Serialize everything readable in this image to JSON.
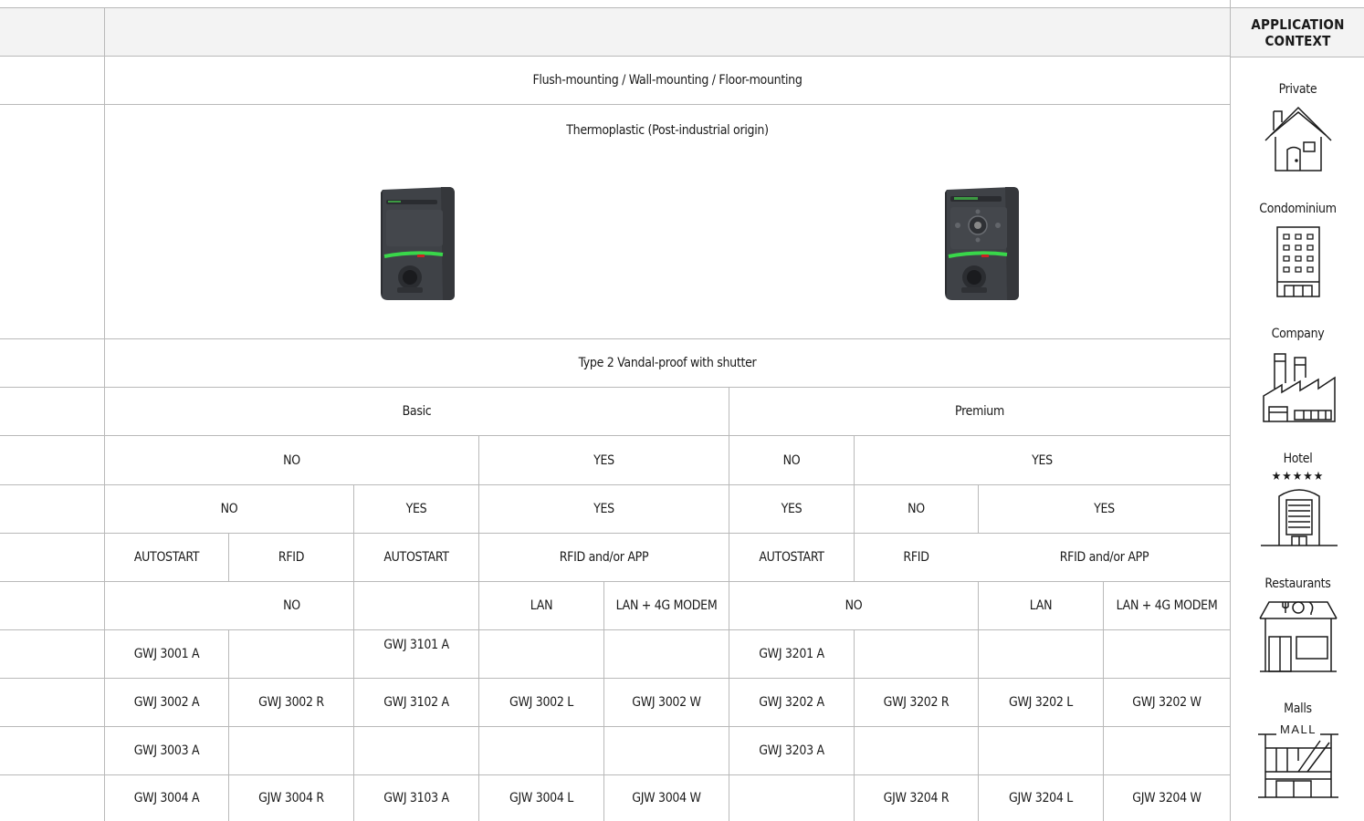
{
  "header": {
    "context_title": "APPLICATION CONTEXT"
  },
  "rows": {
    "mounting": "Flush-mounting / Wall-mounting / Floor-mounting",
    "material": "Thermoplastic (Post-industrial origin)",
    "socket": "Type 2 Vandal-proof with shutter",
    "version": {
      "basic": "Basic",
      "premium": "Premium"
    },
    "row5": [
      "NO",
      "YES",
      "NO",
      "YES"
    ],
    "row6": [
      "NO",
      "YES",
      "YES",
      "YES",
      "NO",
      "YES"
    ],
    "row7": [
      "AUTOSTART",
      "RFID",
      "AUTOSTART",
      "RFID and/or APP",
      "AUTOSTART",
      "RFID",
      "RFID and/or APP"
    ],
    "row8": [
      "NO",
      "LAN",
      "LAN + 4G MODEM",
      "NO",
      "LAN",
      "LAN + 4G MODEM"
    ]
  },
  "codes": [
    [
      "GWJ 3001 A",
      "",
      "GWJ 3101 A",
      "",
      "",
      "GWJ 3201 A",
      "",
      "",
      ""
    ],
    [
      "GWJ 3002 A",
      "GWJ 3002 R",
      "GWJ 3102 A",
      "GWJ 3002 L",
      "GWJ 3002 W",
      "GWJ 3202 A",
      "GWJ 3202 R",
      "GWJ 3202 L",
      "GWJ 3202 W"
    ],
    [
      "GWJ 3003 A",
      "",
      "",
      "",
      "",
      "GWJ 3203 A",
      "",
      "",
      ""
    ],
    [
      "GWJ 3004 A",
      "GJW 3004 R",
      "GWJ 3103 A",
      "GJW 3004 L",
      "GJW 3004 W",
      "",
      "GJW 3204 R",
      "GJW 3204 L",
      "GJW 3204 W"
    ]
  ],
  "contexts": [
    {
      "label": "Private",
      "icon": "house-icon"
    },
    {
      "label": "Condominium",
      "icon": "apartment-building-icon"
    },
    {
      "label": "Company",
      "icon": "factory-icon"
    },
    {
      "label": "Hotel",
      "icon": "hotel-icon",
      "stars": "★★★★★"
    },
    {
      "label": "Restaurants",
      "icon": "restaurant-icon"
    },
    {
      "label": "Malls",
      "icon": "mall-icon",
      "sign": "MALL"
    }
  ],
  "colors": {
    "line": "#b9b9b9",
    "header_bg": "#f3f3f3",
    "led_green": "#39d74a",
    "device_body": "#4a4d52"
  }
}
